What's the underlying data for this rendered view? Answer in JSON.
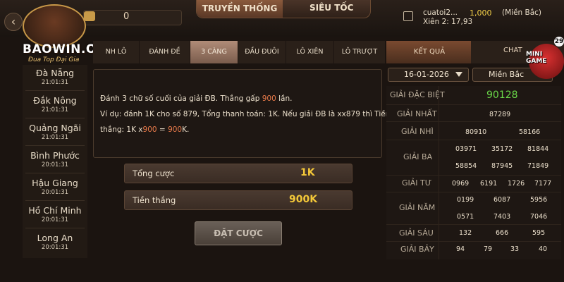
{
  "header": {
    "balance": "0",
    "tabs": [
      "TRUYỀN THỐNG",
      "SIÊU TỐC"
    ],
    "user": {
      "name": "cuatoi2...",
      "amount": "1,000",
      "region": "(Miền Bắc)",
      "bet": "Xiên 2: 17,93"
    }
  },
  "logo": {
    "name": "BAOWIN.ORG",
    "tagline": "Đua Top Đại Gia"
  },
  "cities": [
    {
      "name": "Đà Nẵng",
      "time": "21:01:31"
    },
    {
      "name": "Đắk Nông",
      "time": "21:01:31"
    },
    {
      "name": "Quảng Ngãi",
      "time": "21:01:31"
    },
    {
      "name": "Bình Phước",
      "time": "20:01:31"
    },
    {
      "name": "Hậu Giang",
      "time": "20:01:31"
    },
    {
      "name": "Hồ Chí Minh",
      "time": "20:01:31"
    },
    {
      "name": "Long An",
      "time": "20:01:31"
    }
  ],
  "bet_tabs": [
    "NH LÔ",
    "ĐÁNH ĐỀ",
    "3 CÀNG",
    "ĐẦU ĐUÔI",
    "LÔ XIÊN",
    "LÔ TRƯỢT"
  ],
  "description": {
    "line1_a": "Đánh 3 chữ số cuối của giải ĐB. Thắng gấp ",
    "line1_hl": "900",
    "line1_b": " lần.",
    "line2": "Ví dụ: đánh 1K cho số 879, Tổng thanh toán: 1K. Nếu giải ĐB là xx879 thì Tiền",
    "line3_a": "thắng: 1K x",
    "line3_hl1": "900",
    "line3_b": " = ",
    "line3_hl2": "900",
    "line3_c": "K."
  },
  "bet": {
    "total_label": "Tổng cược",
    "total_value": "1K",
    "win_label": "Tiền thắng",
    "win_value": "900K",
    "place_label": "ĐẶT CƯỢC"
  },
  "results": {
    "tab": "KẾT QUẢ",
    "chat": "CHAT",
    "date": "16-01-2026",
    "region": "Miền Bắc",
    "prizes": {
      "db": {
        "label": "GIẢI ĐẶC BIỆT",
        "nums": [
          "90128"
        ]
      },
      "nhat": {
        "label": "GIẢI NHẤT",
        "nums": [
          "87289"
        ]
      },
      "nhi": {
        "label": "GIẢI NHÌ",
        "nums": [
          "80910",
          "58166"
        ]
      },
      "ba": {
        "label": "GIẢI BA",
        "nums": [
          "03971",
          "35172",
          "81844",
          "58854",
          "87945",
          "71849"
        ]
      },
      "tu": {
        "label": "GIẢI TƯ",
        "nums": [
          "0969",
          "6191",
          "1726",
          "7177"
        ]
      },
      "nam": {
        "label": "GIẢI NĂM",
        "nums": [
          "0199",
          "6087",
          "5956",
          "0571",
          "7403",
          "7046"
        ]
      },
      "sau": {
        "label": "GIẢI SÁU",
        "nums": [
          "132",
          "666",
          "595"
        ]
      },
      "bay": {
        "label": "GIẢI BẢY",
        "nums": [
          "94",
          "79",
          "33",
          "40"
        ]
      }
    }
  },
  "minigame": {
    "label": "MINI GAME",
    "badge": "29"
  }
}
